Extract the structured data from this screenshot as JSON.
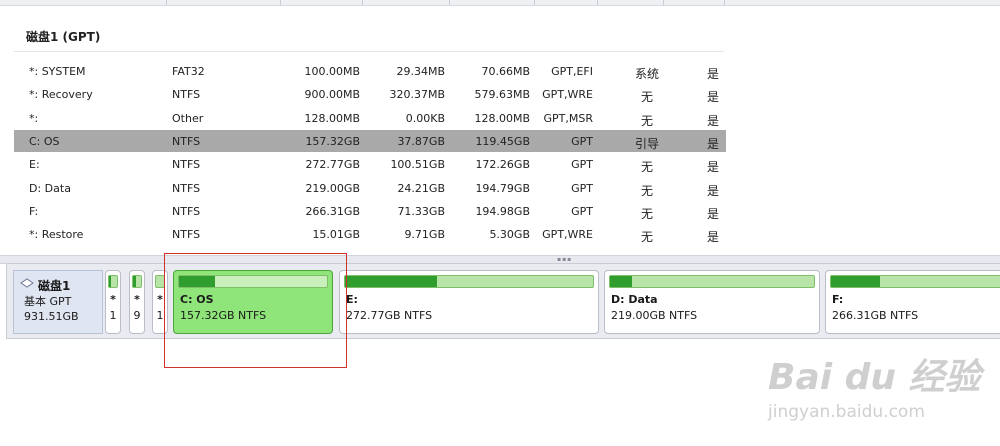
{
  "header": {},
  "disk_title": "磁盘1 (GPT)",
  "partitions": [
    {
      "name": "*: SYSTEM",
      "fs": "FAT32",
      "capacity": "100.00MB",
      "used": "29.34MB",
      "free": "70.66MB",
      "type": "GPT,EFI",
      "status": "系统",
      "active": "是"
    },
    {
      "name": "*: Recovery",
      "fs": "NTFS",
      "capacity": "900.00MB",
      "used": "320.37MB",
      "free": "579.63MB",
      "type": "GPT,WRE",
      "status": "无",
      "active": "是"
    },
    {
      "name": "*:",
      "fs": "Other",
      "capacity": "128.00MB",
      "used": "0.00KB",
      "free": "128.00MB",
      "type": "GPT,MSR",
      "status": "无",
      "active": "是"
    },
    {
      "name": "C: OS",
      "fs": "NTFS",
      "capacity": "157.32GB",
      "used": "37.87GB",
      "free": "119.45GB",
      "type": "GPT",
      "status": "引导",
      "active": "是"
    },
    {
      "name": "E:",
      "fs": "NTFS",
      "capacity": "272.77GB",
      "used": "100.51GB",
      "free": "172.26GB",
      "type": "GPT",
      "status": "无",
      "active": "是"
    },
    {
      "name": "D: Data",
      "fs": "NTFS",
      "capacity": "219.00GB",
      "used": "24.21GB",
      "free": "194.79GB",
      "type": "GPT",
      "status": "无",
      "active": "是"
    },
    {
      "name": "F:",
      "fs": "NTFS",
      "capacity": "266.31GB",
      "used": "71.33GB",
      "free": "194.98GB",
      "type": "GPT",
      "status": "无",
      "active": "是"
    },
    {
      "name": "*: Restore",
      "fs": "NTFS",
      "capacity": "15.01GB",
      "used": "9.71GB",
      "free": "5.30GB",
      "type": "GPT,WRE",
      "status": "无",
      "active": "是"
    }
  ],
  "selected_row_index": 3,
  "diskmap": {
    "disk_name": "磁盘1",
    "disk_type": "基本 GPT",
    "disk_size": "931.51GB",
    "small_parts": [
      {
        "line1": "*",
        "line2": "1"
      },
      {
        "line1": "*",
        "line2": "9"
      },
      {
        "line1": "*",
        "line2": "1"
      }
    ],
    "parts": [
      {
        "name": "C: OS",
        "info": "157.32GB NTFS",
        "used_fraction": 0.24
      },
      {
        "name": "E:",
        "info": "272.77GB NTFS",
        "used_fraction": 0.37
      },
      {
        "name": "D: Data",
        "info": "219.00GB NTFS",
        "used_fraction": 0.11
      },
      {
        "name": "F:",
        "info": "266.31GB NTFS",
        "used_fraction": 0.27
      }
    ]
  },
  "watermark": {
    "brand": "Bai du 经验",
    "url": "jingyan.baidu.com"
  },
  "colors": {
    "selected_row": "#a9a9a9",
    "used_bar": "#2f9e2f",
    "selected_partition": "#8fe47a",
    "highlight_box": "#d0312d"
  }
}
